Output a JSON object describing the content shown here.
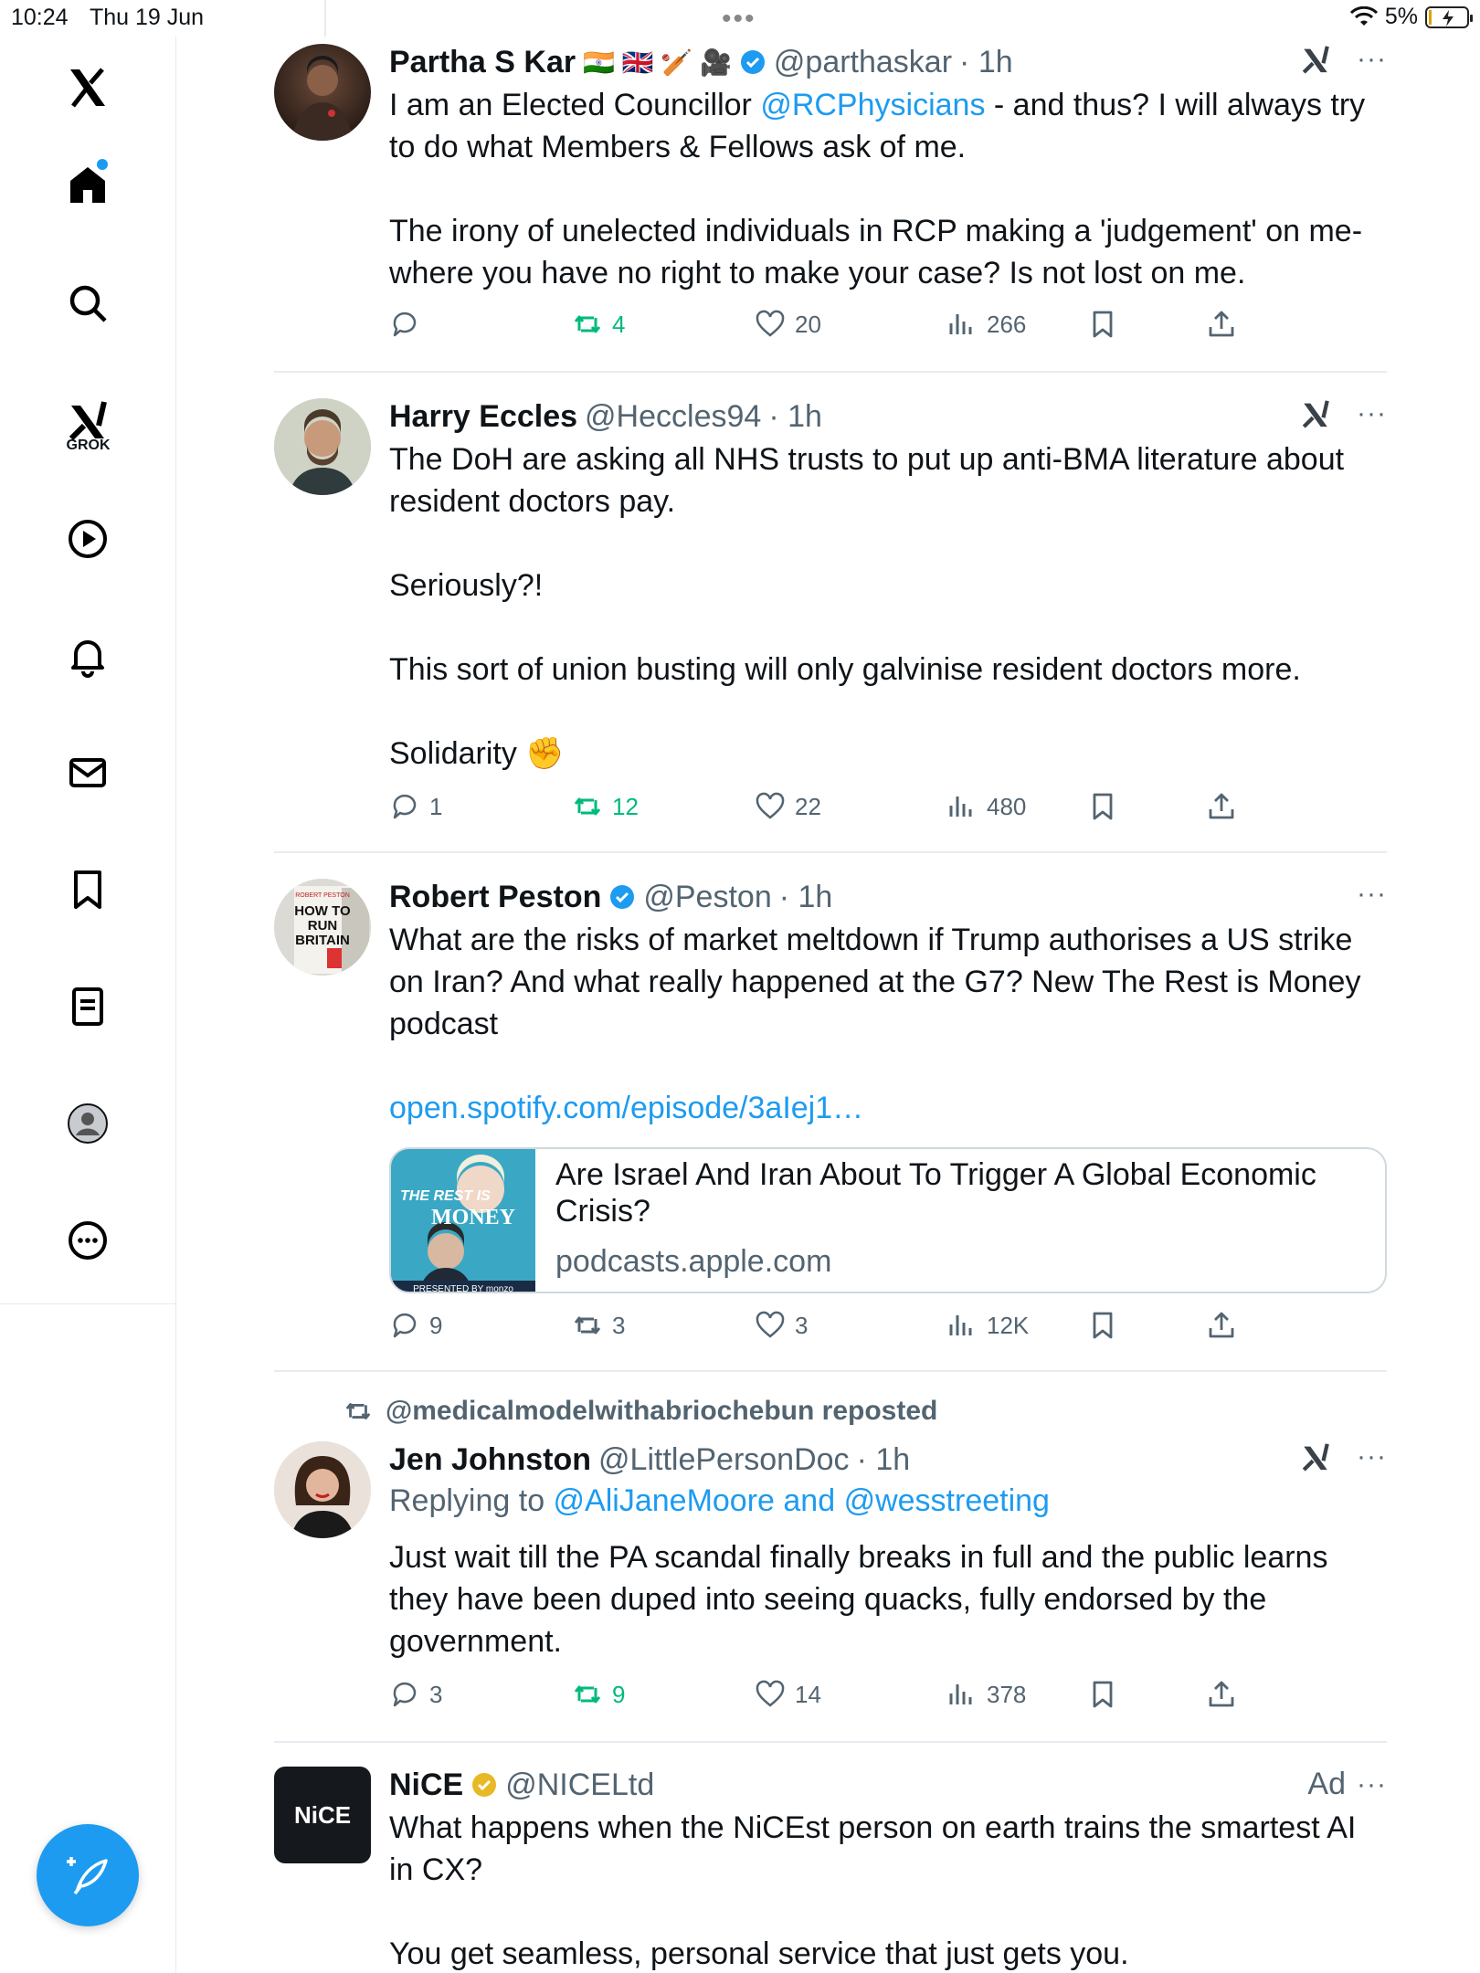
{
  "status_bar": {
    "time": "10:24",
    "date": "Thu 19 Jun",
    "battery": "5%"
  },
  "sidebar": {
    "items": [
      {
        "name": "home",
        "icon": "home-icon"
      },
      {
        "name": "explore",
        "icon": "search-icon"
      },
      {
        "name": "grok",
        "icon": "grok-icon",
        "label": "GROK"
      },
      {
        "name": "videos",
        "icon": "play-icon"
      },
      {
        "name": "notifications",
        "icon": "bell-icon"
      },
      {
        "name": "messages",
        "icon": "mail-icon"
      },
      {
        "name": "bookmarks",
        "icon": "bookmark-icon"
      },
      {
        "name": "lists",
        "icon": "list-icon"
      },
      {
        "name": "profile",
        "icon": "profile-icon"
      },
      {
        "name": "more",
        "icon": "more-circle-icon"
      }
    ],
    "compose_icon": "compose-icon"
  },
  "posts": [
    {
      "name": "Partha S Kar",
      "flags": "🇮🇳 🇬🇧 🏏 🎥",
      "handle": "@parthaskar",
      "time": "· 1h",
      "text_pre": "I am an Elected Councillor ",
      "mention": "@RCPhysicians",
      "text_post": " - and thus? I will always try to do what Members & Fellows ask of me.",
      "text2": "The irony of unelected individuals in RCP making a 'judgement' on me- where you have no right to make your case? Is not lost on me.",
      "replies": "",
      "reposts": "4",
      "likes": "20",
      "views": "266"
    },
    {
      "name": "Harry Eccles",
      "handle": "@Heccles94",
      "time": "· 1h",
      "text1": "The DoH are asking all NHS trusts to put up anti-BMA literature about resident doctors pay.",
      "text2": "Seriously?!",
      "text3": "This sort of union busting will only galvinise resident doctors more.",
      "text4": "Solidarity ✊",
      "replies": "1",
      "reposts": "12",
      "likes": "22",
      "views": "480"
    },
    {
      "name": "Robert Peston",
      "handle": "@Peston",
      "time": "· 1h",
      "text1": "What are the risks of market meltdown if Trump authorises a US strike on Iran? And what really happened at the G7? New The Rest is Money podcast",
      "link": "open.spotify.com/episode/3aIej1…",
      "card_title": "Are Israel And Iran About To Trigger A Global Economic Crisis?",
      "card_domain": "podcasts.apple.com",
      "card_thumb_text1": "THE REST IS",
      "card_thumb_text2": "MONEY",
      "card_thumb_text3": "PRESENTED BY monzo",
      "avatar_text1": "HOW TO",
      "avatar_text2": "RUN",
      "avatar_text3": "BRITAIN",
      "replies": "9",
      "reposts": "3",
      "likes": "3",
      "views": "12K"
    },
    {
      "reposted_by": "@medicalmodelwithabriochebun reposted",
      "name": "Jen Johnston",
      "handle": "@LittlePersonDoc",
      "time": "· 1h",
      "replying_prefix": "Replying to ",
      "replying_targets": "@AliJaneMoore and @wesstreeting",
      "text1": "Just wait till the PA scandal finally breaks in full and the public learns they have been duped into seeing quacks, fully endorsed by the government.",
      "replies": "3",
      "reposts": "9",
      "likes": "14",
      "views": "378"
    },
    {
      "name": "NiCE",
      "handle": "@NICELtd",
      "ad_label": "Ad",
      "avatar_text": "NiCE",
      "text1": "What happens when the NiCEst person on earth trains the smartest AI in CX?",
      "text2": "You get seamless, personal service that just gets you."
    }
  ],
  "colors": {
    "accent": "#1d9bf0",
    "repost_green": "#00ba7c",
    "muted": "#536471",
    "gold_verified": "#e8b825"
  }
}
